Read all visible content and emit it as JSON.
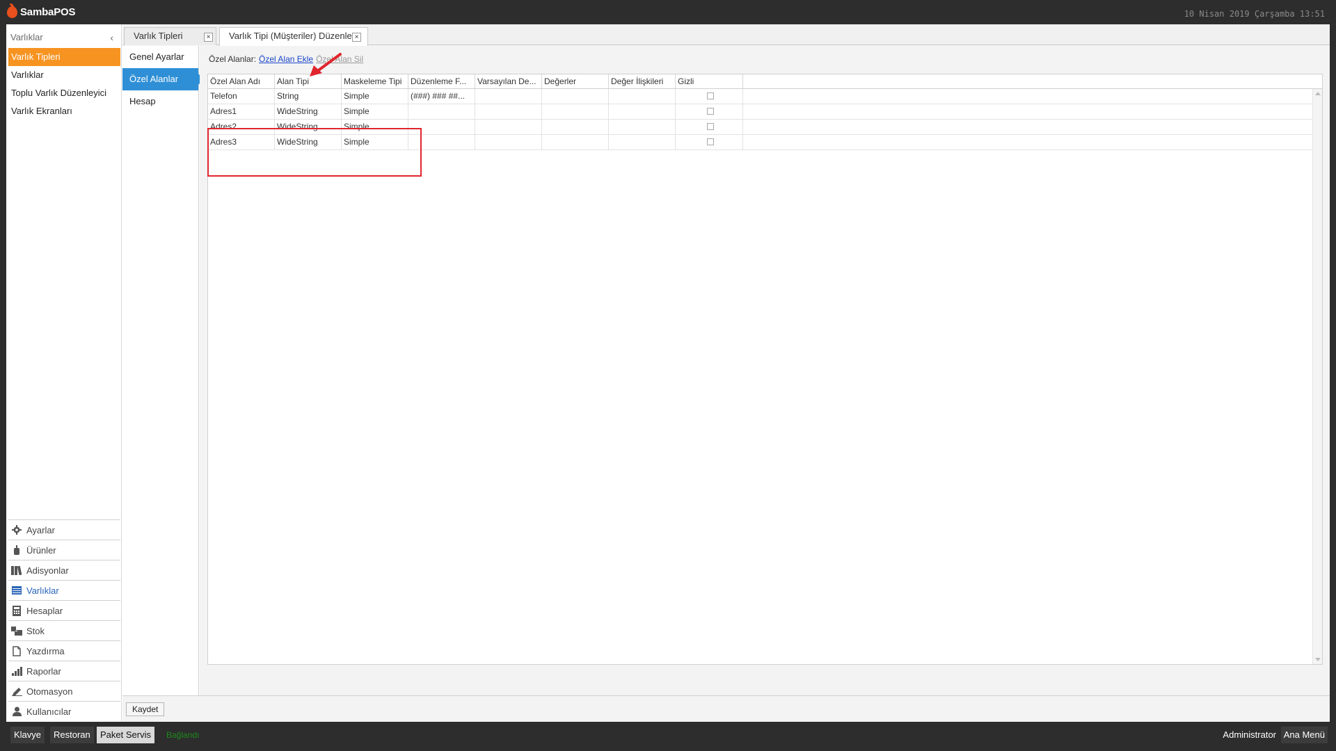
{
  "app": {
    "name": "SambaPOS",
    "clock": "10 Nisan 2019 Çarşamba 13:51"
  },
  "leftnav": {
    "header": "Varlıklar",
    "collapse_glyph": "‹",
    "items": [
      {
        "label": "Varlık Tipleri",
        "active": true
      },
      {
        "label": "Varlıklar"
      },
      {
        "label": "Toplu Varlık Düzenleyici"
      },
      {
        "label": "Varlık Ekranları"
      }
    ]
  },
  "modules": [
    {
      "label": "Ayarlar",
      "icon": "gear-icon"
    },
    {
      "label": "Ürünler",
      "icon": "product-icon"
    },
    {
      "label": "Adisyonlar",
      "icon": "tickets-icon"
    },
    {
      "label": "Varlıklar",
      "icon": "entities-icon",
      "active": true
    },
    {
      "label": "Hesaplar",
      "icon": "calculator-icon"
    },
    {
      "label": "Stok",
      "icon": "inventory-icon"
    },
    {
      "label": "Yazdırma",
      "icon": "document-icon"
    },
    {
      "label": "Raporlar",
      "icon": "bar-chart-icon"
    },
    {
      "label": "Otomasyon",
      "icon": "pen-icon"
    },
    {
      "label": "Kullanıcılar",
      "icon": "user-icon"
    }
  ],
  "tabs": [
    {
      "label": "Varlık Tipleri",
      "close": "×"
    },
    {
      "label": "Varlık Tipi (Müşteriler) Düzenle",
      "close": "×",
      "active": true
    }
  ],
  "subnav": {
    "items": [
      {
        "label": "Genel Ayarlar"
      },
      {
        "label": "Özel Alanlar",
        "active": true
      },
      {
        "label": "Hesap"
      }
    ]
  },
  "toolbar": {
    "label": "Özel Alanlar:",
    "add_link": "Özel Alan Ekle",
    "delete_link": "Özel Alan Sil"
  },
  "grid": {
    "columns": [
      "Özel Alan Adı",
      "Alan Tipi",
      "Maskeleme Tipi",
      "Düzenleme F...",
      "Varsayılan De...",
      "Değerler",
      "Değer İlişkileri",
      "Gizli"
    ],
    "rows": [
      {
        "name": "Telefon",
        "type": "String",
        "mask": "Simple",
        "format": "(###) ### ##...",
        "default": "",
        "values": "",
        "relations": "",
        "hidden": false
      },
      {
        "name": "Adres1",
        "type": "WideString",
        "mask": "Simple",
        "format": "",
        "default": "",
        "values": "",
        "relations": "",
        "hidden": false
      },
      {
        "name": "Adres2",
        "type": "WideString",
        "mask": "Simple",
        "format": "",
        "default": "",
        "values": "",
        "relations": "",
        "hidden": false
      },
      {
        "name": "Adres3",
        "type": "WideString",
        "mask": "Simple",
        "format": "",
        "default": "",
        "values": "",
        "relations": "",
        "hidden": false
      }
    ]
  },
  "footer": {
    "save_label": "Kaydet"
  },
  "statusbar": {
    "buttons": [
      "Klavye",
      "Restoran",
      "Paket Servis"
    ],
    "selected": "Paket Servis",
    "connection": "Bağlandı",
    "user": "Administrator",
    "main_menu": "Ana Menü"
  },
  "colors": {
    "accent_orange": "#f79321",
    "accent_blue": "#2f8fd6",
    "highlight_red": "#e0252d",
    "connected_green": "#1d8a1d"
  }
}
